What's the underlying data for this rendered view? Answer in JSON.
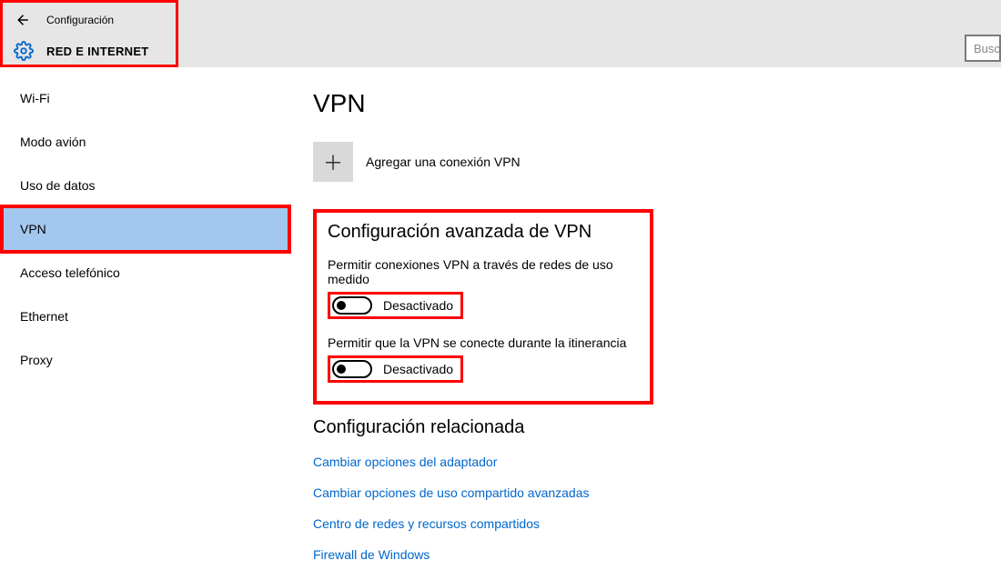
{
  "header": {
    "back_label": "Configuración",
    "section_title": "RED E INTERNET",
    "search_placeholder": "Busca"
  },
  "sidebar": {
    "items": [
      {
        "label": "Wi-Fi",
        "selected": false
      },
      {
        "label": "Modo avión",
        "selected": false
      },
      {
        "label": "Uso de datos",
        "selected": false
      },
      {
        "label": "VPN",
        "selected": true
      },
      {
        "label": "Acceso telefónico",
        "selected": false
      },
      {
        "label": "Ethernet",
        "selected": false
      },
      {
        "label": "Proxy",
        "selected": false
      }
    ]
  },
  "main": {
    "title": "VPN",
    "add_label": "Agregar una conexión VPN",
    "advanced": {
      "heading": "Configuración avanzada de VPN",
      "settings": [
        {
          "label": "Permitir conexiones VPN a través de redes de uso medido",
          "state": "Desactivado",
          "on": false
        },
        {
          "label": "Permitir que la VPN se conecte durante la itinerancia",
          "state": "Desactivado",
          "on": false
        }
      ]
    },
    "related": {
      "heading": "Configuración relacionada",
      "links": [
        "Cambiar opciones del adaptador",
        "Cambiar opciones de uso compartido avanzadas",
        "Centro de redes y recursos compartidos",
        "Firewall de Windows"
      ]
    }
  }
}
